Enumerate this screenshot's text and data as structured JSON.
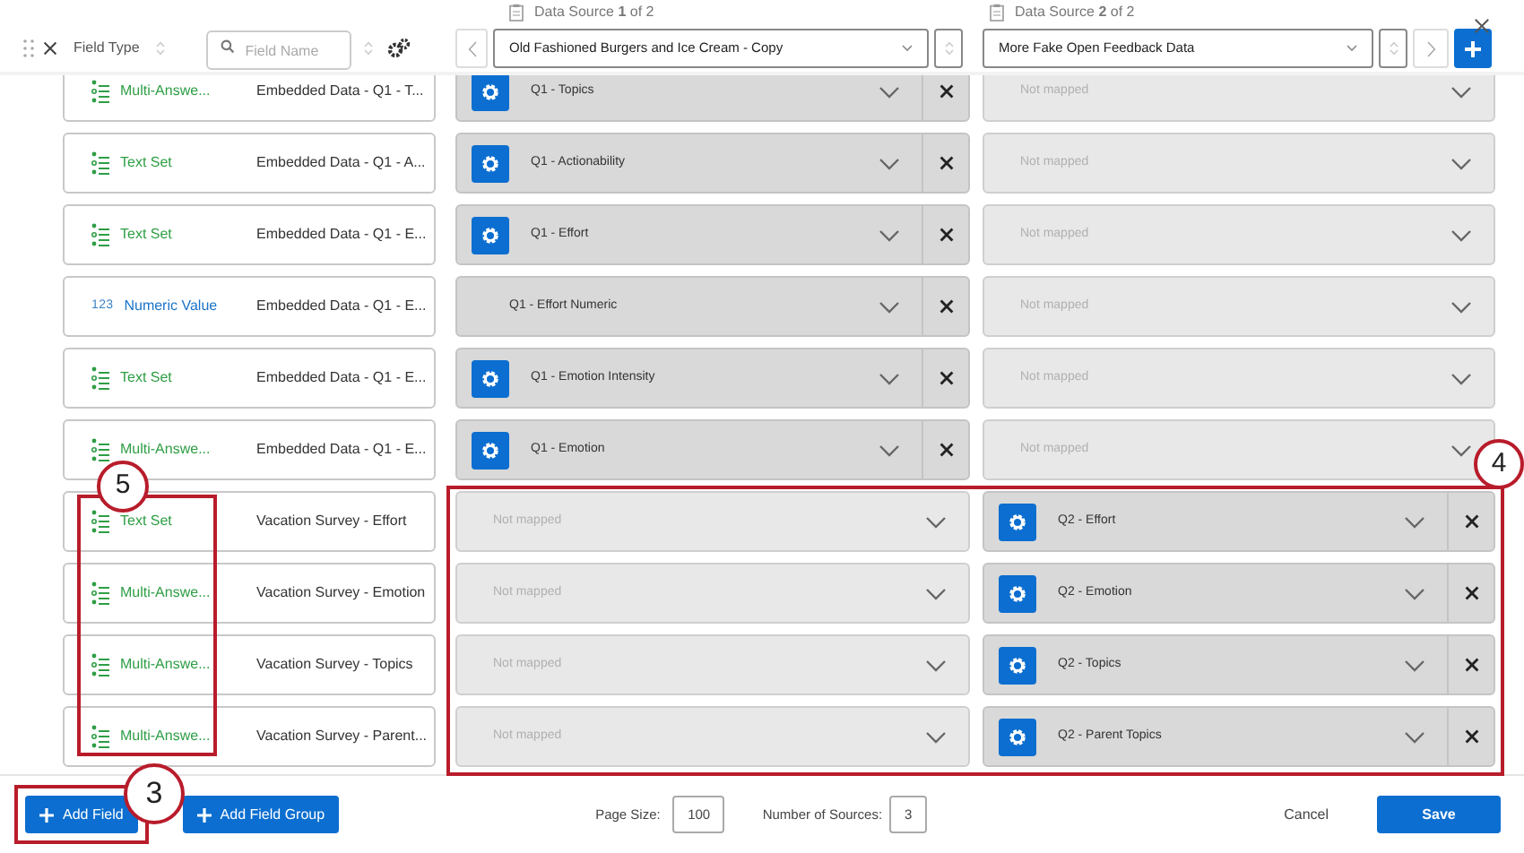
{
  "header": {
    "field_type_label": "Field Type",
    "search": {
      "placeholder": "Field Name"
    },
    "sources": [
      {
        "caption": "Data Source **1** of 2",
        "selected_value": "Old Fashioned Burgers and Ice Cream - Copy"
      },
      {
        "caption": "Data Source **2** of 2",
        "selected_value": "More Fake Open Feedback Data"
      }
    ]
  },
  "rows": [
    {
      "type": {
        "kind": "multi_answer",
        "label": "Multi-Answe..."
      },
      "name": "Embedded Data - Q1 - T...",
      "source_1": {
        "mapped": true,
        "gear": true,
        "label": "Q1 - Topics"
      },
      "source_2": {
        "mapped": false,
        "label": "Not mapped"
      }
    },
    {
      "type": {
        "kind": "text_set",
        "label": "Text Set"
      },
      "name": "Embedded Data - Q1 - A...",
      "source_1": {
        "mapped": true,
        "gear": true,
        "label": "Q1 - Actionability"
      },
      "source_2": {
        "mapped": false,
        "label": "Not mapped"
      }
    },
    {
      "type": {
        "kind": "text_set",
        "label": "Text Set"
      },
      "name": "Embedded Data - Q1 - E...",
      "source_1": {
        "mapped": true,
        "gear": true,
        "label": "Q1 - Effort"
      },
      "source_2": {
        "mapped": false,
        "label": "Not mapped"
      }
    },
    {
      "type": {
        "kind": "numeric",
        "label": "Numeric Value",
        "icon_text": "123"
      },
      "name": "Embedded Data - Q1 - E...",
      "source_1": {
        "mapped": true,
        "gear": false,
        "label": "Q1 - Effort Numeric"
      },
      "source_2": {
        "mapped": false,
        "label": "Not mapped"
      }
    },
    {
      "type": {
        "kind": "text_set",
        "label": "Text Set"
      },
      "name": "Embedded Data - Q1 - E...",
      "source_1": {
        "mapped": true,
        "gear": true,
        "label": "Q1 - Emotion Intensity"
      },
      "source_2": {
        "mapped": false,
        "label": "Not mapped"
      }
    },
    {
      "type": {
        "kind": "multi_answer",
        "label": "Multi-Answe..."
      },
      "name": "Embedded Data - Q1 - E...",
      "source_1": {
        "mapped": true,
        "gear": true,
        "label": "Q1 - Emotion"
      },
      "source_2": {
        "mapped": false,
        "label": "Not mapped"
      }
    },
    {
      "type": {
        "kind": "text_set",
        "label": "Text Set"
      },
      "name": "Vacation Survey - Effort",
      "source_1": {
        "mapped": false,
        "label": "Not mapped"
      },
      "source_2": {
        "mapped": true,
        "gear": true,
        "label": "Q2 - Effort"
      }
    },
    {
      "type": {
        "kind": "multi_answer",
        "label": "Multi-Answe..."
      },
      "name": "Vacation Survey - Emotion",
      "source_1": {
        "mapped": false,
        "label": "Not mapped"
      },
      "source_2": {
        "mapped": true,
        "gear": true,
        "label": "Q2 - Emotion"
      }
    },
    {
      "type": {
        "kind": "multi_answer",
        "label": "Multi-Answe..."
      },
      "name": "Vacation Survey - Topics",
      "source_1": {
        "mapped": false,
        "label": "Not mapped"
      },
      "source_2": {
        "mapped": true,
        "gear": true,
        "label": "Q2 - Topics"
      }
    },
    {
      "type": {
        "kind": "multi_answer",
        "label": "Multi-Answe..."
      },
      "name": "Vacation Survey - Parent...",
      "source_1": {
        "mapped": false,
        "label": "Not mapped"
      },
      "source_2": {
        "mapped": true,
        "gear": true,
        "label": "Q2 - Parent Topics"
      }
    }
  ],
  "footer": {
    "add_field": "Add Field",
    "add_field_group": "Add Field Group",
    "page_size_label": "Page Size:",
    "page_size": "100",
    "sources_label": "Number of Sources:",
    "sources": "3",
    "cancel": "Cancel",
    "save": "Save"
  },
  "annotations": [
    {
      "label": "5"
    },
    {
      "label": "4"
    },
    {
      "label": "3"
    }
  ]
}
